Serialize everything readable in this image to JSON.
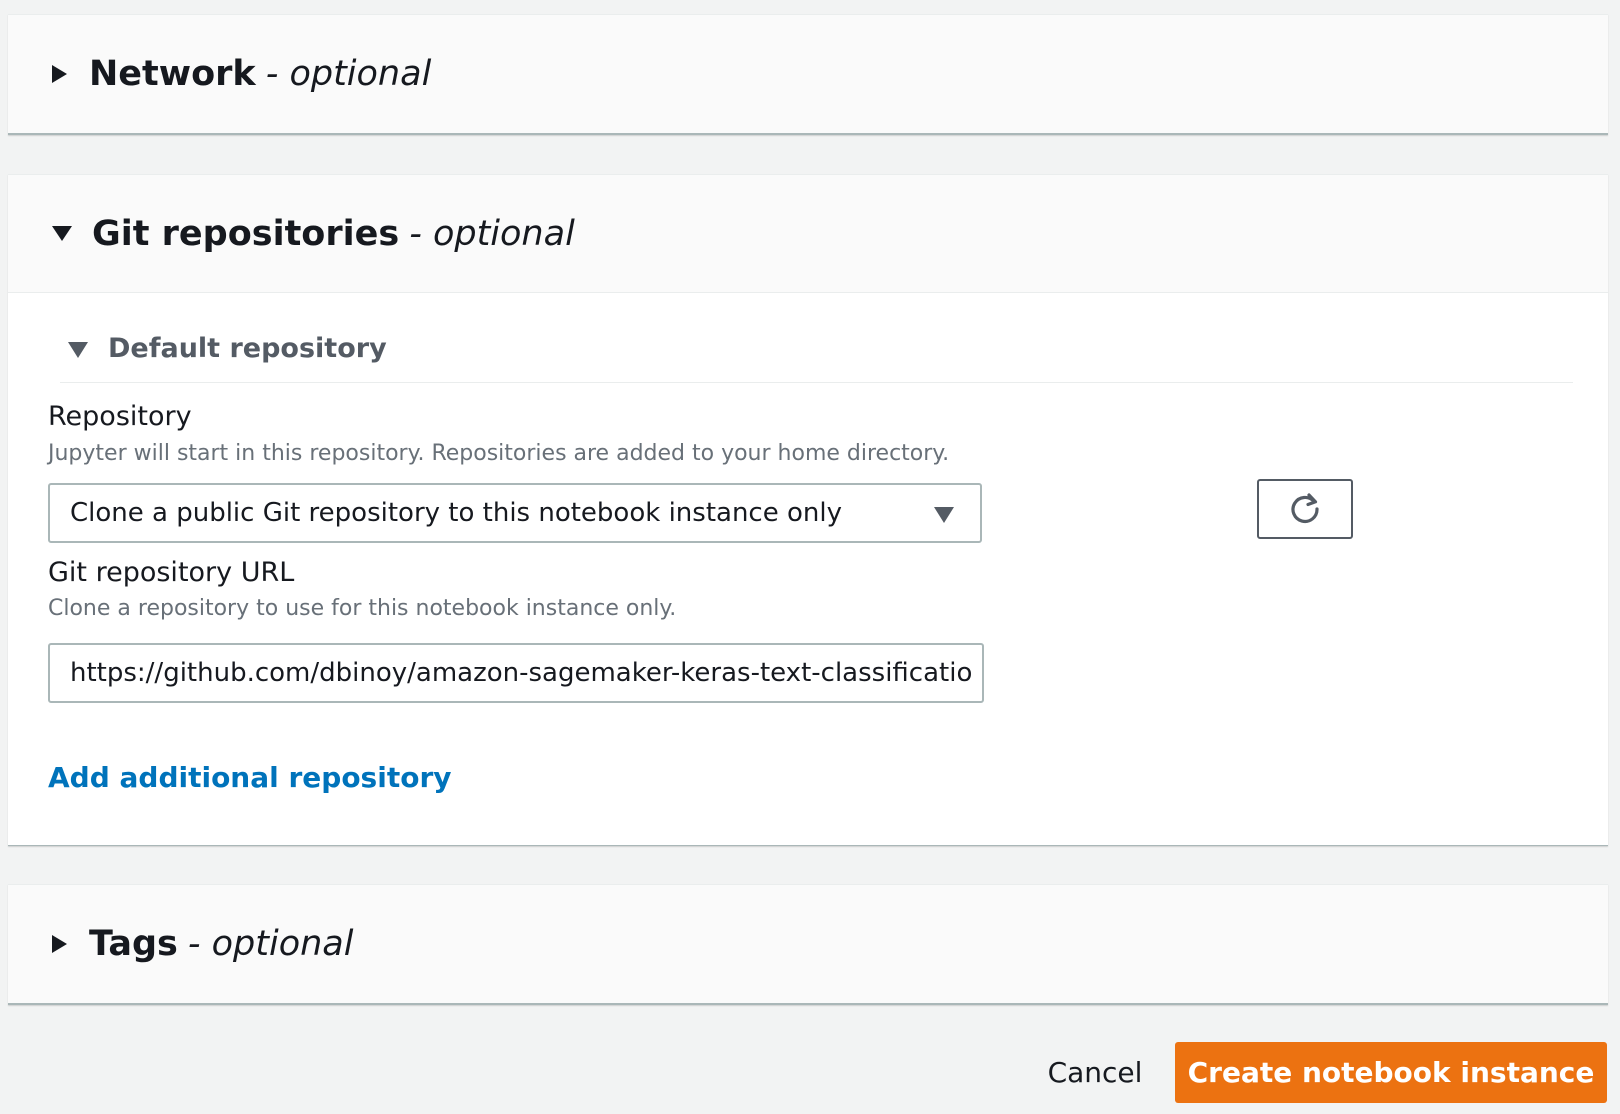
{
  "sections": {
    "network": {
      "title": "Network",
      "optional": "- optional"
    },
    "git": {
      "title": "Git repositories",
      "optional": "- optional",
      "default_repository": {
        "title": "Default repository",
        "repository_label": "Repository",
        "repository_description": "Jupyter will start in this repository. Repositories are added to your home directory.",
        "repository_selected": "Clone a public Git repository to this notebook instance only",
        "url_label": "Git repository URL",
        "url_description": "Clone a repository to use for this notebook instance only.",
        "url_value": "https://github.com/dbinoy/amazon-sagemaker-keras-text-classificatio"
      },
      "add_link": "Add additional repository"
    },
    "tags": {
      "title": "Tags",
      "optional": "- optional"
    }
  },
  "footer": {
    "cancel_label": "Cancel",
    "create_label": "Create notebook instance"
  },
  "colors": {
    "accent": "#ec7211",
    "link": "#0073bb",
    "background": "#f2f3f3"
  },
  "icons": {
    "refresh": "refresh-icon",
    "collapsed": "caret-right-icon",
    "expanded": "caret-down-icon"
  }
}
